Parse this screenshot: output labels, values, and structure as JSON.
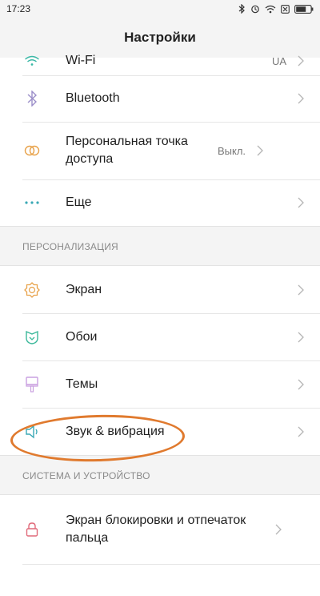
{
  "status": {
    "time": "17:23"
  },
  "header": {
    "title": "Настройки"
  },
  "network_items": [
    {
      "label": "Wi-Fi",
      "value": "UA",
      "icon": "wifi-icon"
    },
    {
      "label": "Bluetooth",
      "value": "",
      "icon": "bluetooth-icon"
    },
    {
      "label": "Персональная точка доступа",
      "value": "Выкл.",
      "icon": "hotspot-icon"
    },
    {
      "label": "Еще",
      "value": "",
      "icon": "more-dots-icon"
    }
  ],
  "sections": [
    {
      "title": "ПЕРСОНАЛИЗАЦИЯ"
    },
    {
      "title": "СИСТЕМА И УСТРОЙСТВО"
    }
  ],
  "personalization_items": [
    {
      "label": "Экран",
      "icon": "brightness-icon"
    },
    {
      "label": "Обои",
      "icon": "wallpaper-icon"
    },
    {
      "label": "Темы",
      "icon": "themes-brush-icon"
    },
    {
      "label": "Звук & вибрация",
      "icon": "speaker-icon"
    }
  ],
  "system_items": [
    {
      "label": "Экран блокировки и отпечаток пальца",
      "icon": "lock-icon"
    }
  ],
  "colors": {
    "background": "#f4f4f4",
    "card": "#ffffff",
    "wifi": "#3bb8a6",
    "bluetooth": "#9b8ec9",
    "hotspot": "#e8a24a",
    "more": "#3aa9b5",
    "display": "#e8a24a",
    "wallpaper": "#3bb89a",
    "themes": "#c9a0e0",
    "sound": "#3aa9b5",
    "lock": "#e06a7a",
    "highlight": "#e07a2e"
  }
}
